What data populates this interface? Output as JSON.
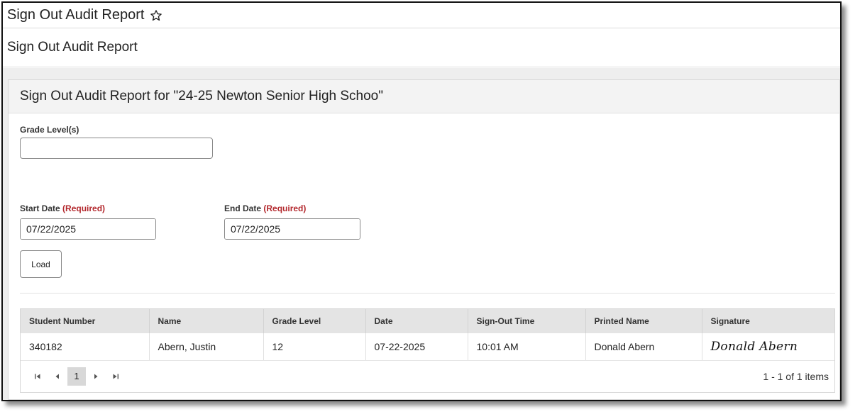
{
  "header": {
    "title": "Sign Out Audit Report"
  },
  "subheader": {
    "title": "Sign Out Audit Report"
  },
  "panel": {
    "title": "Sign Out Audit Report for \"24-25 Newton Senior High Schoo\"",
    "grade_label": "Grade Level(s)",
    "grade_value": "",
    "start_label": "Start Date",
    "end_label": "End Date",
    "required_text": "(Required)",
    "start_value": "07/22/2025",
    "end_value": "07/22/2025",
    "load_label": "Load"
  },
  "grid": {
    "columns": [
      "Student Number",
      "Name",
      "Grade Level",
      "Date",
      "Sign-Out Time",
      "Printed Name",
      "Signature"
    ],
    "rows": [
      {
        "student_number": "340182",
        "name": "Abern, Justin",
        "grade_level": "12",
        "date": "07-22-2025",
        "time": "10:01 AM",
        "printed_name": "Donald Abern",
        "signature": "Donald Abern"
      }
    ]
  },
  "pager": {
    "current_page": "1",
    "info": "1 - 1 of 1 items"
  },
  "colors": {
    "required": "#b3282d",
    "header_bg": "#e4e4e4",
    "pager_active": "#d8d8d8"
  }
}
